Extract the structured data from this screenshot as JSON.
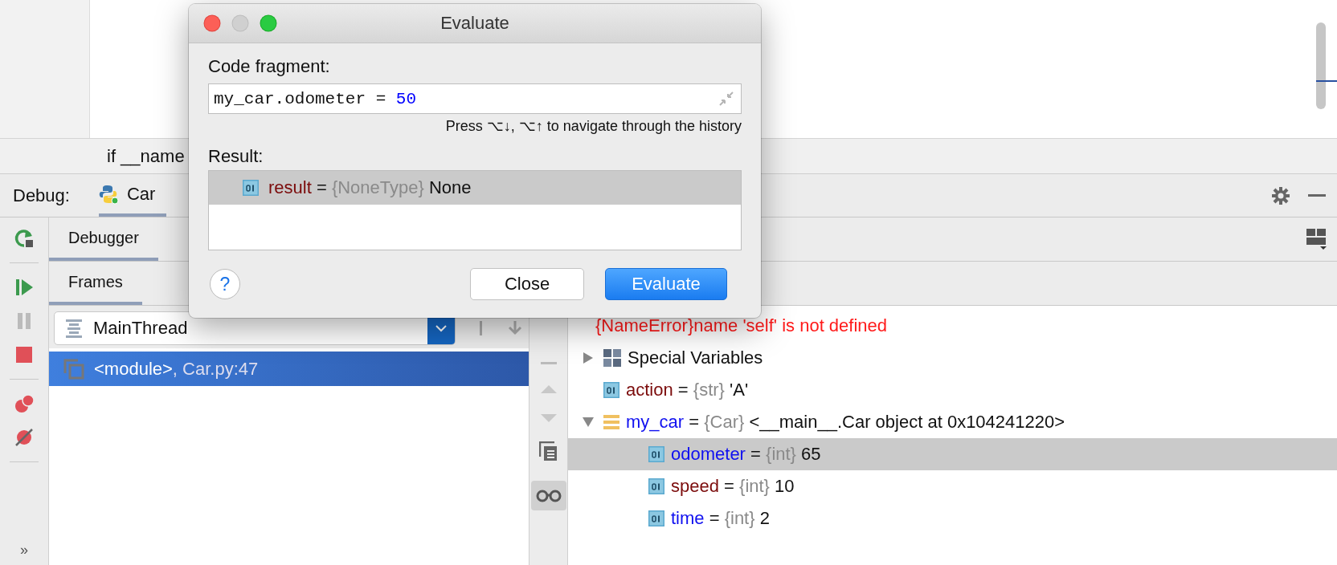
{
  "editor": {
    "breadcrumb": "if __name"
  },
  "debug_bar": {
    "label": "Debug:",
    "session_tab": {
      "label": "Car",
      "selected": true
    }
  },
  "toolbar_more": "»",
  "tabs": [
    {
      "label": "Debugger",
      "selected": true
    }
  ],
  "frames_tab": {
    "label": "Frames",
    "selected": true
  },
  "thread": "MainThread",
  "frames": [
    {
      "label": "<module>",
      "location": ", Car.py:47",
      "selected": true
    }
  ],
  "variables": [
    {
      "kind": "error",
      "value": "{NameError}name 'self' is not defined"
    },
    {
      "kind": "group",
      "name": "Special Variables",
      "expanded": false
    },
    {
      "kind": "value",
      "name": "action",
      "color": "#7b0b0b",
      "sep": "=",
      "type": "{str}",
      "value": "'A'",
      "selected": false
    },
    {
      "kind": "object",
      "name": "my_car",
      "color": "#1010f0",
      "sep": "=",
      "type": "{Car}",
      "value": "<__main__.Car object at 0x104241220>",
      "expanded": true,
      "selected": false,
      "children": [
        {
          "kind": "value",
          "name": "odometer",
          "color": "#1010f0",
          "sep": "=",
          "type": "{int}",
          "value": "65",
          "selected": true
        },
        {
          "kind": "value",
          "name": "speed",
          "color": "#7b0b0b",
          "sep": "=",
          "type": "{int}",
          "value": "10",
          "selected": false
        },
        {
          "kind": "value",
          "name": "time",
          "color": "#1010f0",
          "sep": "=",
          "type": "{int}",
          "value": "2",
          "selected": false
        }
      ]
    }
  ],
  "dialog": {
    "title": "Evaluate",
    "code_label": "Code fragment:",
    "code": [
      {
        "text": "my_car.odometer = ",
        "kind": "plain"
      },
      {
        "text": "50",
        "kind": "number"
      }
    ],
    "hint": "Press ⌥↓, ⌥↑ to navigate through the history",
    "result_label": "Result:",
    "results": [
      {
        "name": "result",
        "color": "#7b0b0b",
        "sep": "=",
        "type": "{NoneType}",
        "value": "None",
        "selected": true
      }
    ],
    "help": "?",
    "buttons": [
      {
        "label": "Close",
        "kind": "default"
      },
      {
        "label": "Evaluate",
        "kind": "primary"
      }
    ]
  }
}
